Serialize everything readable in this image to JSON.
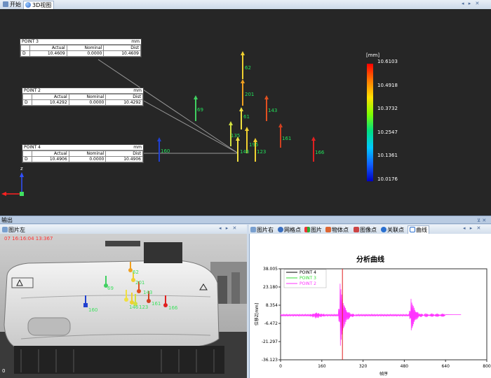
{
  "tabs": [
    {
      "label": "开始"
    },
    {
      "label": "3D视图"
    }
  ],
  "view3d": {
    "axis_label": "z",
    "colorbar": {
      "unit": "[mm]",
      "ticks": [
        "10.6103",
        "10.4918",
        "10.3732",
        "10.2547",
        "10.1361",
        "10.0176"
      ]
    },
    "tables": [
      {
        "title": "POINT 3",
        "unit": "mm",
        "headers": [
          "Actual",
          "Nominal",
          "Dist"
        ],
        "row_label": "D",
        "values": [
          "10.4609",
          "0.0000",
          "10.4609"
        ]
      },
      {
        "title": "POINT 2",
        "unit": "mm",
        "headers": [
          "Actual",
          "Nominal",
          "Dist"
        ],
        "row_label": "D",
        "values": [
          "10.4292",
          "0.0000",
          "10.4292"
        ]
      },
      {
        "title": "POINT 4",
        "unit": "mm",
        "headers": [
          "Actual",
          "Nominal",
          "Dist"
        ],
        "row_label": "D",
        "values": [
          "10.4906",
          "0.0000",
          "10.4906"
        ]
      }
    ],
    "markers": [
      {
        "label": "62",
        "color": "#f0d030"
      },
      {
        "label": "201",
        "color": "#f0a020"
      },
      {
        "label": "69",
        "color": "#40d060"
      },
      {
        "label": "143",
        "color": "#e05020"
      },
      {
        "label": "61",
        "color": "#f0e040"
      },
      {
        "label": "161",
        "color": "#d04020"
      },
      {
        "label": "135",
        "color": "#d0e040"
      },
      {
        "label": "195",
        "color": "#f0d030"
      },
      {
        "label": "160",
        "color": "#2040d0"
      },
      {
        "label": "146",
        "color": "#f0e040"
      },
      {
        "label": "123",
        "color": "#f0d030"
      },
      {
        "label": "166",
        "color": "#e02020"
      }
    ]
  },
  "output": {
    "title": "输出",
    "left_panel": {
      "tab": "图片左",
      "timestamp": "07 16:16:04 13:367",
      "corner": "0"
    },
    "right_tabs": [
      "图片右",
      "网格点",
      "图片",
      "物体点",
      "图像点",
      "关联点",
      "曲线"
    ],
    "photo_labels": [
      "62",
      "201",
      "69",
      "143",
      "161",
      "166",
      "123",
      "146",
      "160"
    ]
  },
  "chart_data": {
    "type": "line",
    "title": "分析曲线",
    "xlabel": "帧序",
    "ylabel": "位移Z[mm]",
    "xlim": [
      0,
      800
    ],
    "ylim": [
      -36.123,
      38.005
    ],
    "xticks": [
      "0",
      "160",
      "320",
      "480",
      "640",
      "800"
    ],
    "yticks": [
      "38.005",
      "23.180",
      "8.354",
      "-6.472",
      "-21.297",
      "-36.123"
    ],
    "series": [
      {
        "name": "POINT 4",
        "color": "#000000"
      },
      {
        "name": "POINT 3",
        "color": "#33dd33"
      },
      {
        "name": "POINT 2",
        "color": "#ff33ff"
      }
    ],
    "cursor_x": 240,
    "baseline": 0.2,
    "events": [
      {
        "x": 230,
        "min": -31,
        "max": 33
      },
      {
        "x": 505,
        "min": -10,
        "max": 24
      }
    ]
  }
}
